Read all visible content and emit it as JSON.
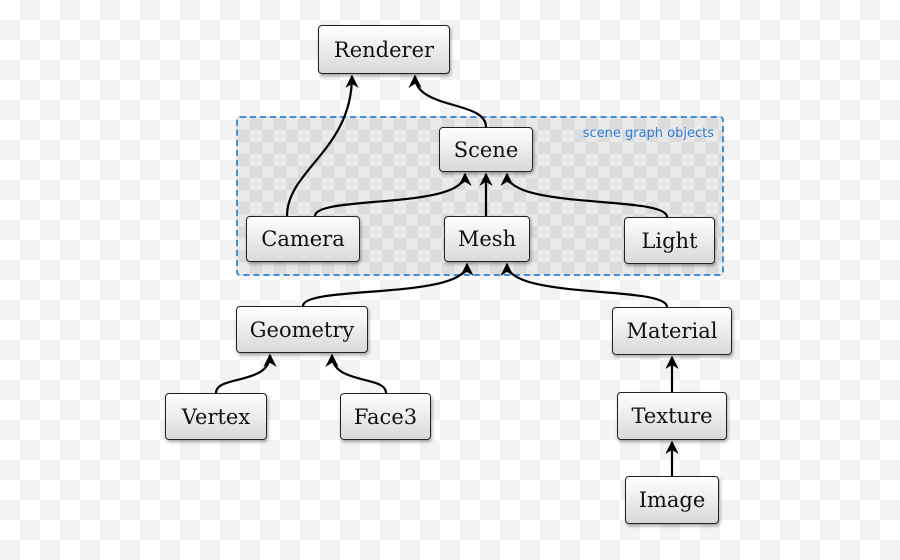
{
  "group": {
    "label": "scene graph objects",
    "border_color": "#3f8fdc"
  },
  "nodes": {
    "renderer": "Renderer",
    "scene": "Scene",
    "camera": "Camera",
    "mesh": "Mesh",
    "light": "Light",
    "geometry": "Geometry",
    "material": "Material",
    "vertex": "Vertex",
    "face3": "Face3",
    "texture": "Texture",
    "image": "Image"
  },
  "edges": [
    [
      "camera",
      "renderer"
    ],
    [
      "scene",
      "renderer"
    ],
    [
      "camera",
      "scene"
    ],
    [
      "mesh",
      "scene"
    ],
    [
      "light",
      "scene"
    ],
    [
      "geometry",
      "mesh"
    ],
    [
      "material",
      "mesh"
    ],
    [
      "vertex",
      "geometry"
    ],
    [
      "face3",
      "geometry"
    ],
    [
      "texture",
      "material"
    ],
    [
      "image",
      "texture"
    ]
  ]
}
